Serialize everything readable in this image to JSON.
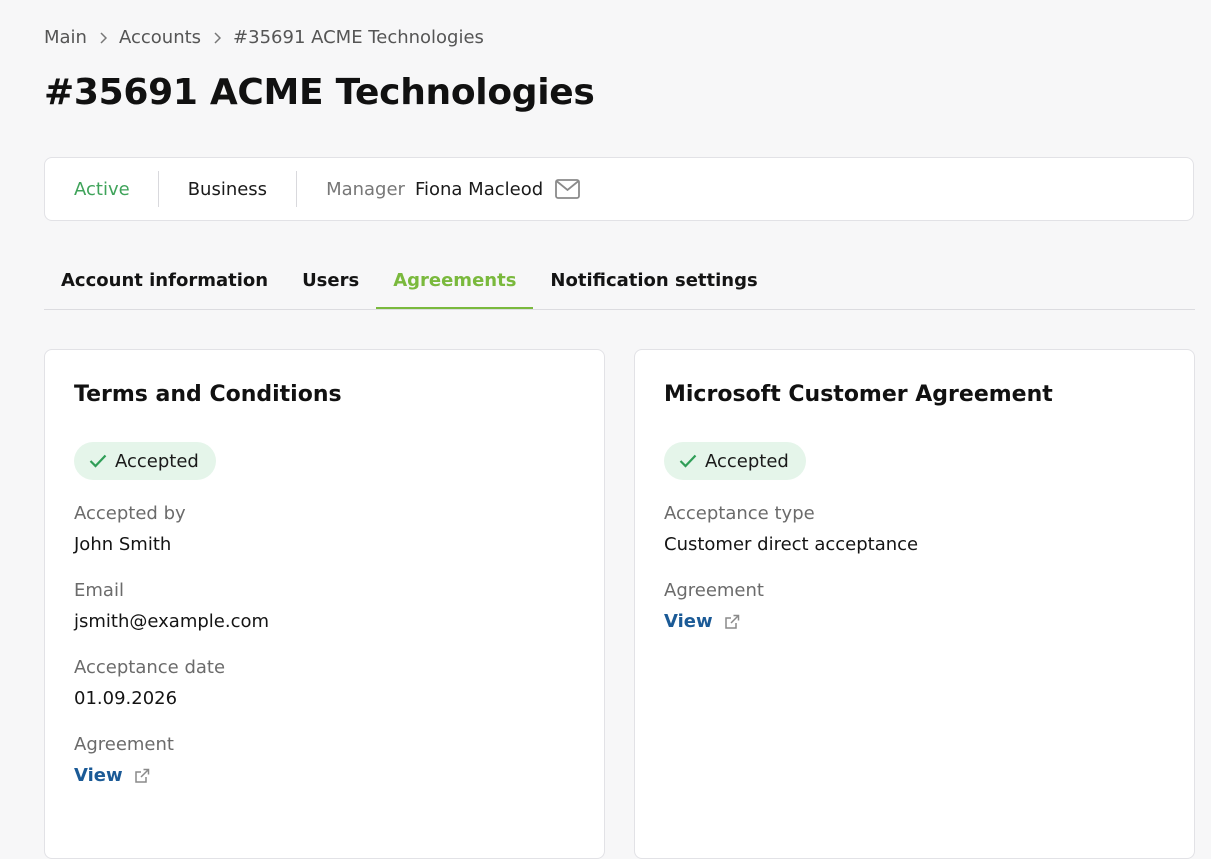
{
  "breadcrumb": {
    "items": [
      "Main",
      "Accounts",
      "#35691 ACME Technologies"
    ]
  },
  "page": {
    "title": "#35691 ACME Technologies"
  },
  "status": {
    "state": "Active",
    "type": "Business",
    "manager_label": "Manager",
    "manager_name": "Fiona Macleod"
  },
  "tabs": [
    {
      "label": "Account information",
      "active": false
    },
    {
      "label": "Users",
      "active": false
    },
    {
      "label": "Agreements",
      "active": true
    },
    {
      "label": "Notification settings",
      "active": false
    }
  ],
  "agreements": {
    "terms": {
      "title": "Terms and Conditions",
      "status": "Accepted",
      "accepted_by_label": "Accepted by",
      "accepted_by": "John Smith",
      "email_label": "Email",
      "email": "jsmith@example.com",
      "date_label": "Acceptance date",
      "date": "01.09.2026",
      "agreement_label": "Agreement",
      "view_label": "View"
    },
    "microsoft": {
      "title": "Microsoft Customer Agreement",
      "status": "Accepted",
      "type_label": "Acceptance type",
      "type": "Customer direct acceptance",
      "agreement_label": "Agreement",
      "view_label": "View"
    }
  },
  "colors": {
    "accent": "#7ab93d",
    "active_status": "#3fa35a",
    "link": "#1b5a96",
    "badge_bg": "#e5f5ea",
    "check": "#2f9e57"
  },
  "icons": {
    "breadcrumb_separator": "chevron-right-icon",
    "manager_contact": "mail-icon",
    "badge": "check-icon",
    "view_link": "external-link-icon"
  }
}
